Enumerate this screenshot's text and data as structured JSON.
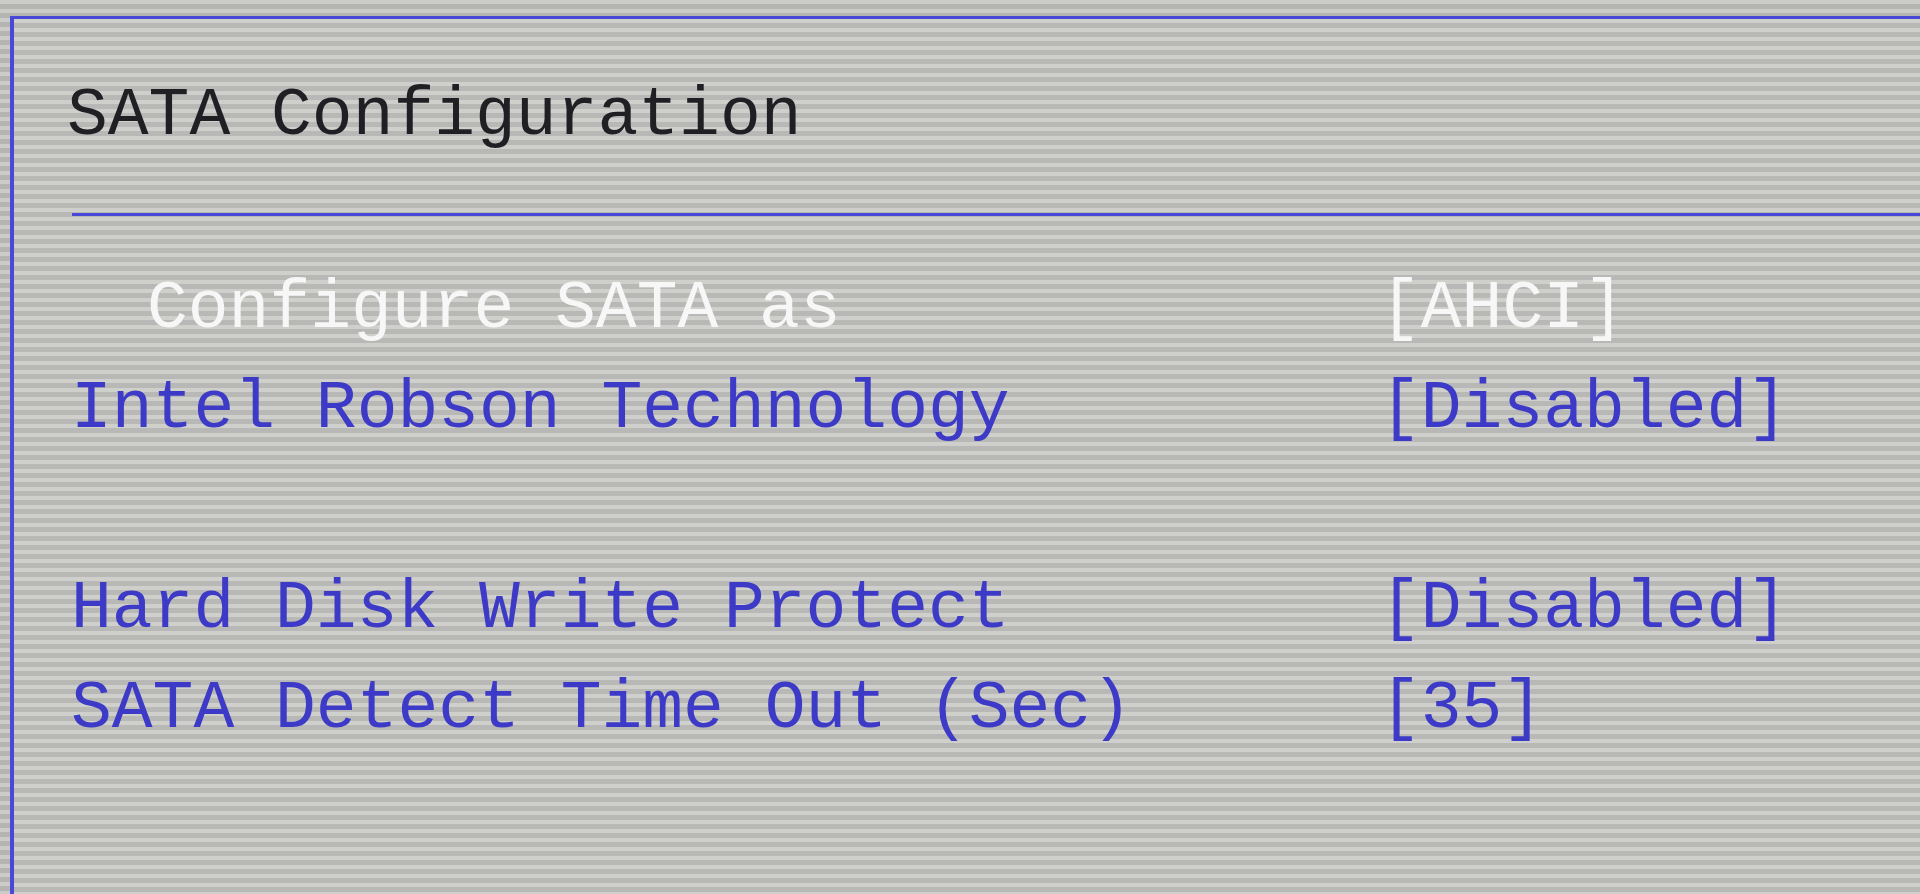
{
  "title": "SATA Configuration",
  "groups": [
    {
      "items": [
        {
          "label": "Configure SATA as",
          "value": "[AHCI]",
          "selected": true
        },
        {
          "label": "Intel Robson Technology",
          "value": "[Disabled]",
          "selected": false
        }
      ]
    },
    {
      "items": [
        {
          "label": "Hard Disk Write Protect",
          "value": "[Disabled]",
          "selected": false
        },
        {
          "label": "SATA Detect Time Out (Sec)",
          "value": "[35]",
          "selected": false
        }
      ]
    }
  ]
}
